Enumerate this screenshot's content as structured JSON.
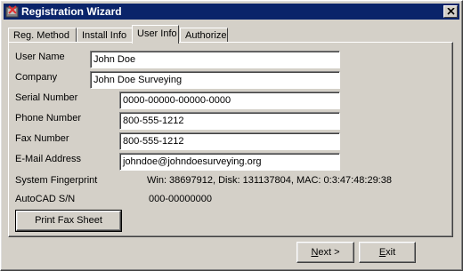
{
  "window": {
    "title": "Registration Wizard",
    "icon": "app-icon"
  },
  "tabs": [
    {
      "label": "Reg. Method",
      "active": false
    },
    {
      "label": "Install Info",
      "active": false
    },
    {
      "label": "User Info",
      "active": true
    },
    {
      "label": "Authorize",
      "active": false
    }
  ],
  "form": {
    "user_name": {
      "label": "User Name",
      "value": "John Doe"
    },
    "company": {
      "label": "Company",
      "value": "John Doe Surveying"
    },
    "serial_number": {
      "label": "Serial Number",
      "value": "0000-00000-00000-0000"
    },
    "phone_number": {
      "label": "Phone Number",
      "value": "800-555-1212"
    },
    "fax_number": {
      "label": "Fax Number",
      "value": "800-555-1212"
    },
    "email": {
      "label": "E-Mail Address",
      "value": "johndoe@johndoesurveying.org"
    },
    "fingerprint": {
      "label": "System Fingerprint",
      "value": "Win: 38697912, Disk: 131137804, MAC: 0:3:47:48:29:38"
    },
    "autocad_sn": {
      "label": "AutoCAD S/N",
      "value": "000-00000000"
    }
  },
  "buttons": {
    "print_fax": "Print Fax Sheet",
    "next_accel": "N",
    "next_rest": "ext >",
    "exit_accel": "E",
    "exit_rest": "xit"
  },
  "colors": {
    "titlebar": "#0a246a",
    "face": "#d4d0c8"
  }
}
